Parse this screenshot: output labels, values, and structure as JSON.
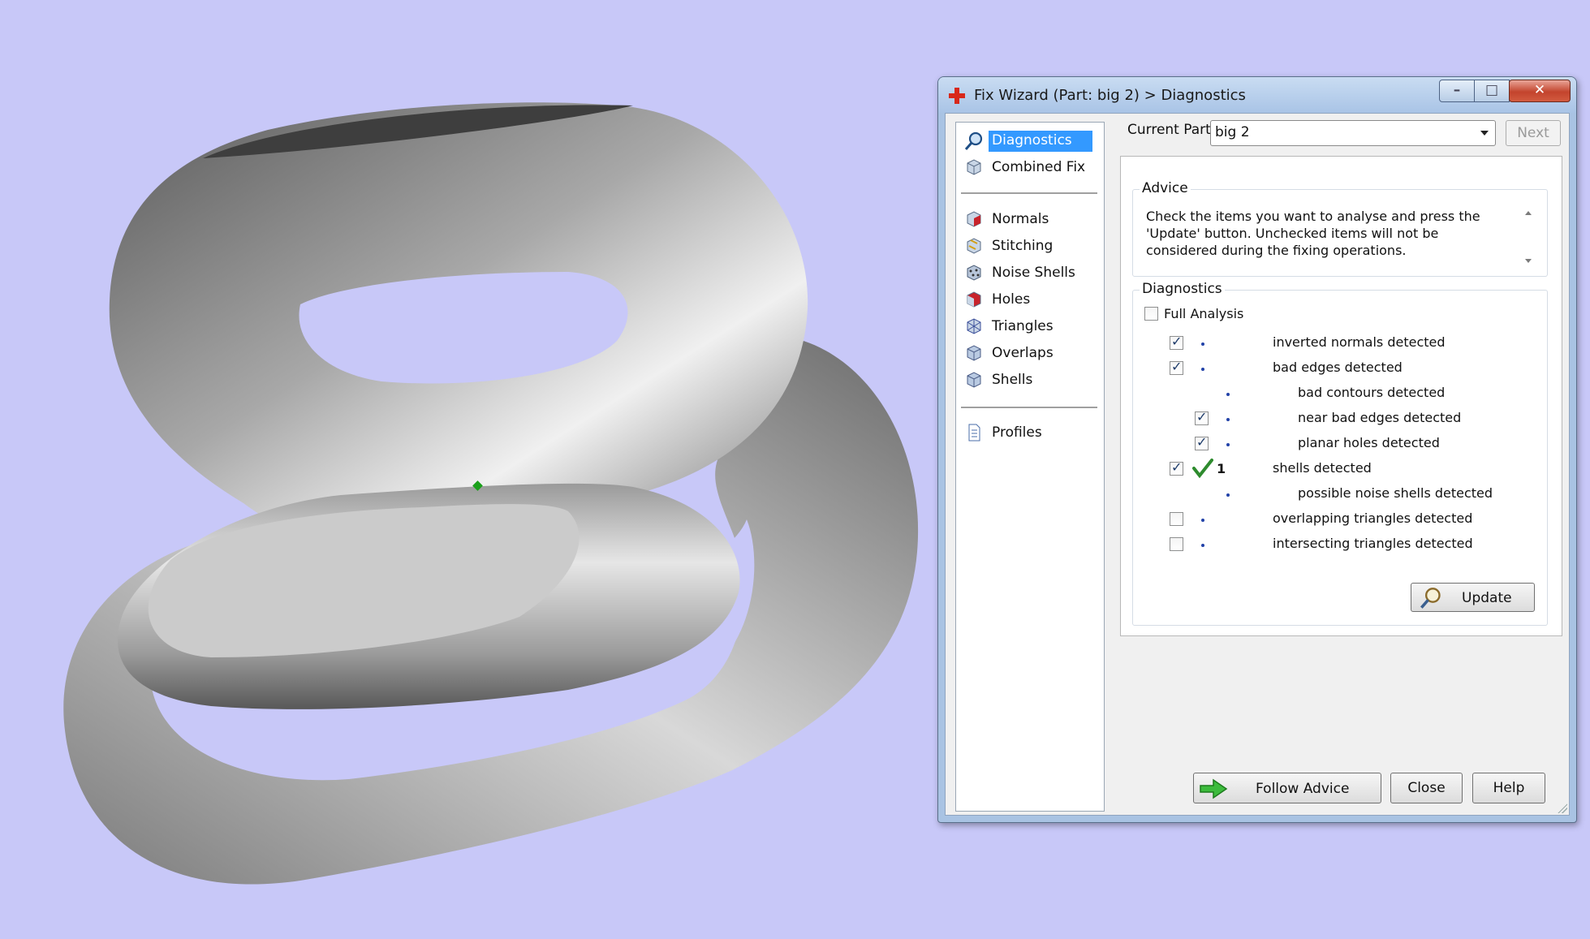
{
  "window": {
    "title": "Fix Wizard (Part: big 2) > Diagnostics",
    "min_label": "–",
    "max_label": "□",
    "close_label": "✕"
  },
  "nav": {
    "items": [
      {
        "id": "diagnostics",
        "label": "Diagnostics",
        "icon": "magnifier-icon",
        "selected": true
      },
      {
        "id": "combined-fix",
        "label": "Combined Fix",
        "icon": "cube-icon"
      },
      {
        "id": "normals",
        "label": "Normals",
        "icon": "red-cube-icon"
      },
      {
        "id": "stitching",
        "label": "Stitching",
        "icon": "stitch-cube-icon"
      },
      {
        "id": "noise-shells",
        "label": "Noise Shells",
        "icon": "dotted-cube-icon"
      },
      {
        "id": "holes",
        "label": "Holes",
        "icon": "red-cube-icon"
      },
      {
        "id": "triangles",
        "label": "Triangles",
        "icon": "triangle-cube-icon"
      },
      {
        "id": "overlaps",
        "label": "Overlaps",
        "icon": "cube-icon"
      },
      {
        "id": "shells",
        "label": "Shells",
        "icon": "cube-icon"
      },
      {
        "id": "profiles",
        "label": "Profiles",
        "icon": "document-icon"
      }
    ]
  },
  "current_part": {
    "label": "Current Part:",
    "value": "big 2"
  },
  "next_label": "Next",
  "advice": {
    "title": "Advice",
    "text": "Check the items you want to analyse and press the 'Update' button. Unchecked items will not be considered during the fixing operations."
  },
  "diagnostics": {
    "title": "Diagnostics",
    "full_analysis_label": "Full Analysis",
    "rows": [
      {
        "label": "inverted normals detected",
        "checked": true,
        "has_checkbox": true,
        "indent": 0,
        "status": "dot"
      },
      {
        "label": "bad edges detected",
        "checked": true,
        "has_checkbox": true,
        "indent": 0,
        "status": "dot"
      },
      {
        "label": "bad contours detected",
        "checked": false,
        "has_checkbox": false,
        "indent": 1,
        "status": "dot"
      },
      {
        "label": "near bad edges detected",
        "checked": true,
        "has_checkbox": true,
        "indent": 1,
        "status": "dot"
      },
      {
        "label": "planar holes detected",
        "checked": true,
        "has_checkbox": true,
        "indent": 1,
        "status": "dot"
      },
      {
        "label": "shells detected",
        "checked": true,
        "has_checkbox": true,
        "indent": 0,
        "status": "ok",
        "count": "1"
      },
      {
        "label": "possible noise shells detected",
        "checked": false,
        "has_checkbox": false,
        "indent": 1,
        "status": "dot"
      },
      {
        "label": "overlapping triangles detected",
        "checked": false,
        "has_checkbox": true,
        "indent": 0,
        "status": "dot"
      },
      {
        "label": "intersecting triangles detected",
        "checked": false,
        "has_checkbox": true,
        "indent": 0,
        "status": "dot"
      }
    ],
    "update_label": "Update"
  },
  "buttons": {
    "follow_advice": "Follow Advice",
    "close": "Close",
    "help": "Help"
  },
  "colors": {
    "background": "#c8c8f8",
    "selection": "#3399ff",
    "ok_check": "#2e8b2e",
    "marker": "#1aa01a"
  }
}
